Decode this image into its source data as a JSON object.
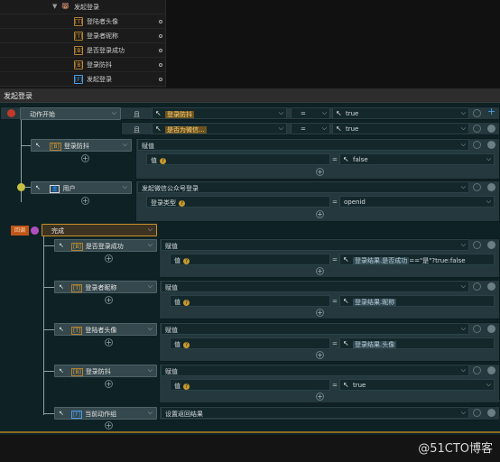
{
  "tree": {
    "root_label": "发起登录",
    "items": [
      {
        "icon": "[T]",
        "label": "登陆者头像"
      },
      {
        "icon": "[T]",
        "label": "登录者昵称"
      },
      {
        "icon": "[B]",
        "label": "是否登录成功"
      },
      {
        "icon": "[B]",
        "label": "登录防抖"
      },
      {
        "icon": "[F]",
        "label": "发起登录"
      }
    ]
  },
  "panel": {
    "title": "发起登录"
  },
  "action_start": {
    "label": "动作开始",
    "and_label": "且",
    "or_label": "且",
    "cond1": {
      "left": "登录防抖",
      "op": "=",
      "right": "true"
    },
    "cond2": {
      "left": "是否为微信...",
      "op": "=",
      "right": "true"
    }
  },
  "block1": {
    "target": "登录防抖",
    "action": "赋值",
    "param_label": "值",
    "op": "=",
    "value": "false"
  },
  "block2": {
    "target": "用户",
    "action": "发起微信公众号登录",
    "param_label": "登录类型",
    "op": "=",
    "value": "openid"
  },
  "complete": {
    "tag": "回调",
    "label": "完成"
  },
  "block3": {
    "target": "是否登录成功",
    "action": "赋值",
    "param_label": "值",
    "op": "=",
    "expr_hl": "登录结果.是否成功",
    "expr_rest": "==\"是\"?true:false"
  },
  "block4": {
    "target": "登录者昵称",
    "action": "赋值",
    "param_label": "值",
    "op": "=",
    "expr_hl": "登录结果.昵称"
  },
  "block5": {
    "target": "登陆者头像",
    "action": "赋值",
    "param_label": "值",
    "op": "=",
    "expr_hl": "登录结果.头像"
  },
  "block6": {
    "target": "登录防抖",
    "action": "赋值",
    "param_label": "值",
    "op": "=",
    "value": "true"
  },
  "block7": {
    "target": "当前动作组",
    "action": "设置返回结果"
  },
  "watermark": "@51CTO博客"
}
